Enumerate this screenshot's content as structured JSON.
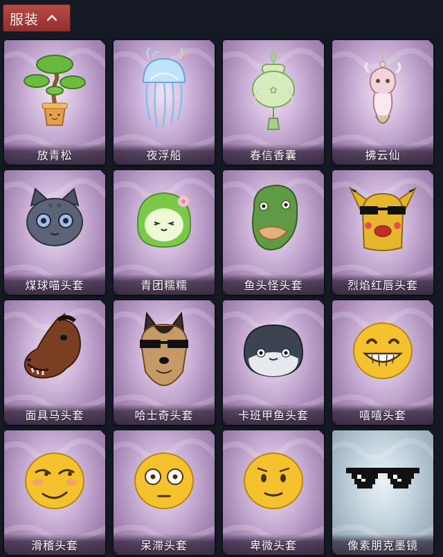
{
  "header": {
    "title": "服装",
    "toggle_icon": "chevron-up-icon"
  },
  "colors": {
    "header_bg": "#a43d39",
    "page_bg": "#141924",
    "card_purple": "#b899c6",
    "card_blue": "#a9bccb"
  },
  "items": [
    {
      "name": "放青松",
      "icon": "bonsai-pine-icon",
      "frame": "purple"
    },
    {
      "name": "夜浮船",
      "icon": "jellyfish-icon",
      "frame": "purple"
    },
    {
      "name": "春信香囊",
      "icon": "sachet-pouch-icon",
      "frame": "purple"
    },
    {
      "name": "拂云仙",
      "icon": "dragon-charm-icon",
      "frame": "purple"
    },
    {
      "name": "煤球喵头套",
      "icon": "cat-head-icon",
      "frame": "purple"
    },
    {
      "name": "青团糯糯",
      "icon": "green-rice-ball-head-icon",
      "frame": "purple"
    },
    {
      "name": "鱼头怪头套",
      "icon": "fish-head-icon",
      "frame": "purple"
    },
    {
      "name": "烈焰红唇头套",
      "icon": "yellow-lips-head-icon",
      "frame": "purple"
    },
    {
      "name": "面具马头套",
      "icon": "horse-head-icon",
      "frame": "purple"
    },
    {
      "name": "哈士奇头套",
      "icon": "husky-head-icon",
      "frame": "purple"
    },
    {
      "name": "卡班甲鱼头套",
      "icon": "fish-blob-head-icon",
      "frame": "purple"
    },
    {
      "name": "嘻嘻头套",
      "icon": "grin-emoji-head-icon",
      "frame": "purple"
    },
    {
      "name": "滑稽头套",
      "icon": "smirk-emoji-head-icon",
      "frame": "purple"
    },
    {
      "name": "呆滞头套",
      "icon": "blank-stare-emoji-head-icon",
      "frame": "purple"
    },
    {
      "name": "卑微头套",
      "icon": "shy-emoji-head-icon",
      "frame": "purple"
    },
    {
      "name": "像素朋克墨镜",
      "icon": "pixel-sunglasses-icon",
      "frame": "blue"
    }
  ]
}
